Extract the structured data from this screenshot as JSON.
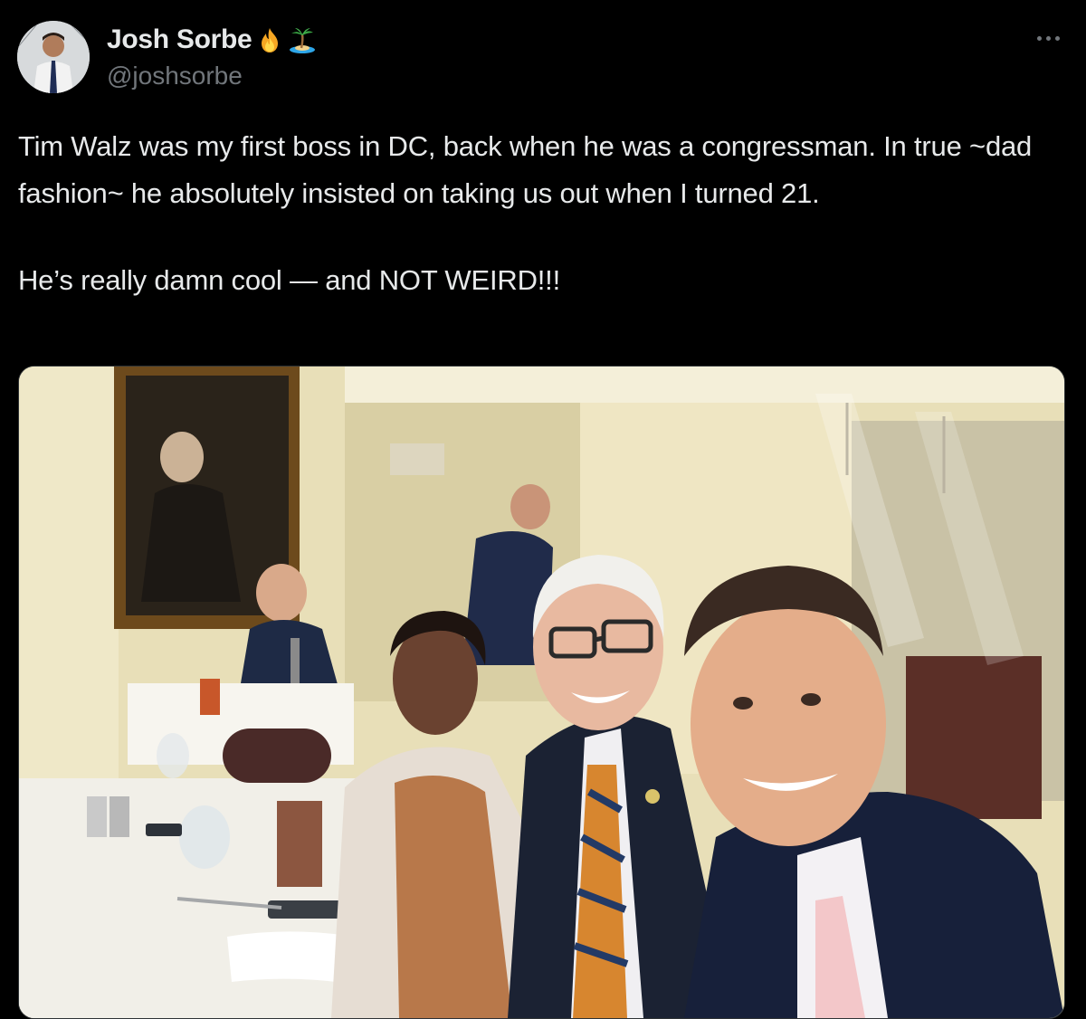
{
  "author": {
    "display_name": "Josh Sorbe",
    "handle": "@joshsorbe",
    "badge_icons": [
      "fire-emoji-icon",
      "palm-island-emoji-icon"
    ]
  },
  "tweet": {
    "paragraph_1": "Tim Walz was my first boss in DC, back when he was a congressman. In true ~dad fashion~ he absolutely insisted on taking us out when I turned 21.",
    "paragraph_2": "He’s really damn cool — and NOT WEIRD!!!"
  },
  "media": {
    "type": "photo"
  },
  "colors": {
    "background": "#000000",
    "primary_text": "#e7e9ea",
    "secondary_text": "#71767b"
  }
}
